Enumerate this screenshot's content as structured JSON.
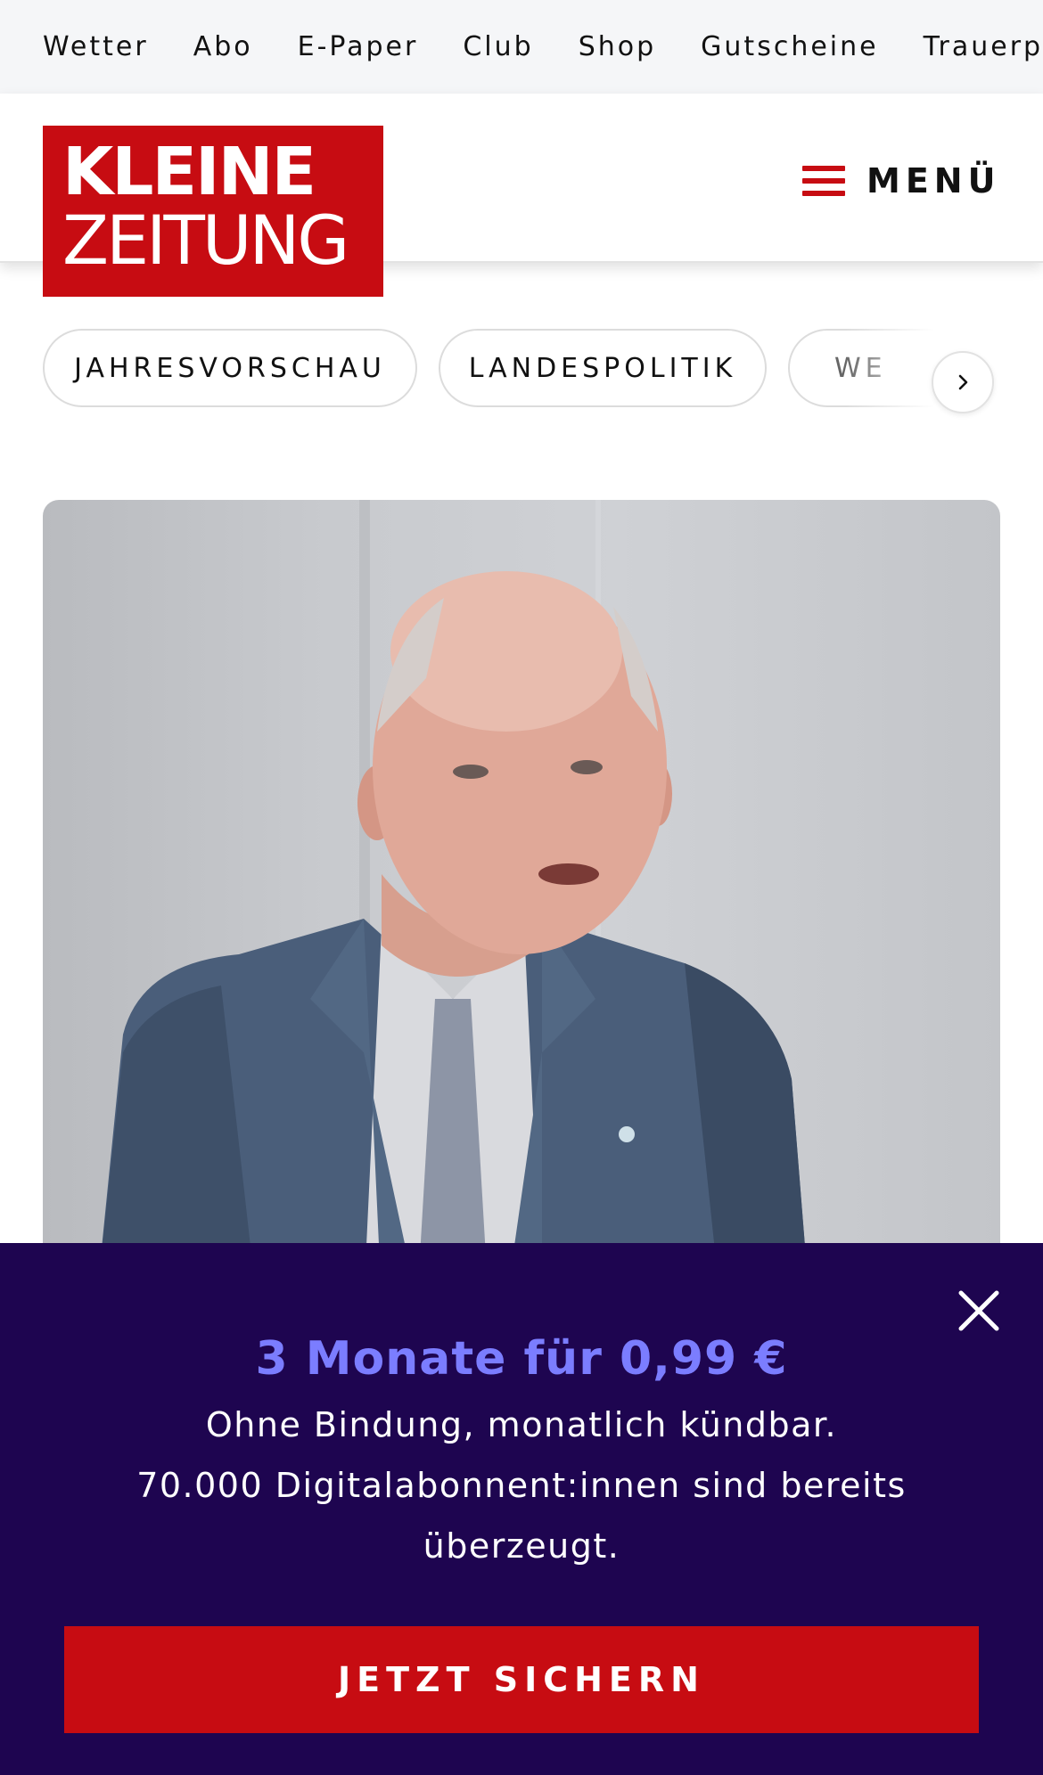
{
  "top_nav": {
    "items": [
      {
        "label": "Wetter"
      },
      {
        "label": "Abo"
      },
      {
        "label": "E-Paper"
      },
      {
        "label": "Club"
      },
      {
        "label": "Shop"
      },
      {
        "label": "Gutscheine"
      },
      {
        "label": "Trauerpo"
      }
    ]
  },
  "header": {
    "logo": {
      "line1": "KLEINE",
      "line2": "ZEITUNG"
    },
    "menu_label": "MENÜ",
    "menu_icon": "hamburger-icon"
  },
  "topic_pills": {
    "items": [
      {
        "label": "JAHRESVORSCHAU"
      },
      {
        "label": "LANDESPOLITIK"
      },
      {
        "label": "WE"
      }
    ],
    "next_icon": "chevron-right-icon"
  },
  "hero": {
    "image": "portrait-photo"
  },
  "promo": {
    "close_icon": "close-icon",
    "headline": "3 Monate für 0,99 €",
    "line1": "Ohne Bindung, monatlich kündbar.",
    "line2": "70.000 Digitalabonnent:innen sind bereits",
    "line3": "überzeugt.",
    "cta_label": "JETZT SICHERN"
  },
  "colors": {
    "brand_red": "#c70c12",
    "promo_bg": "#1e0550",
    "promo_headline": "#7b7dff",
    "nav_bg": "#f5f6f8"
  }
}
